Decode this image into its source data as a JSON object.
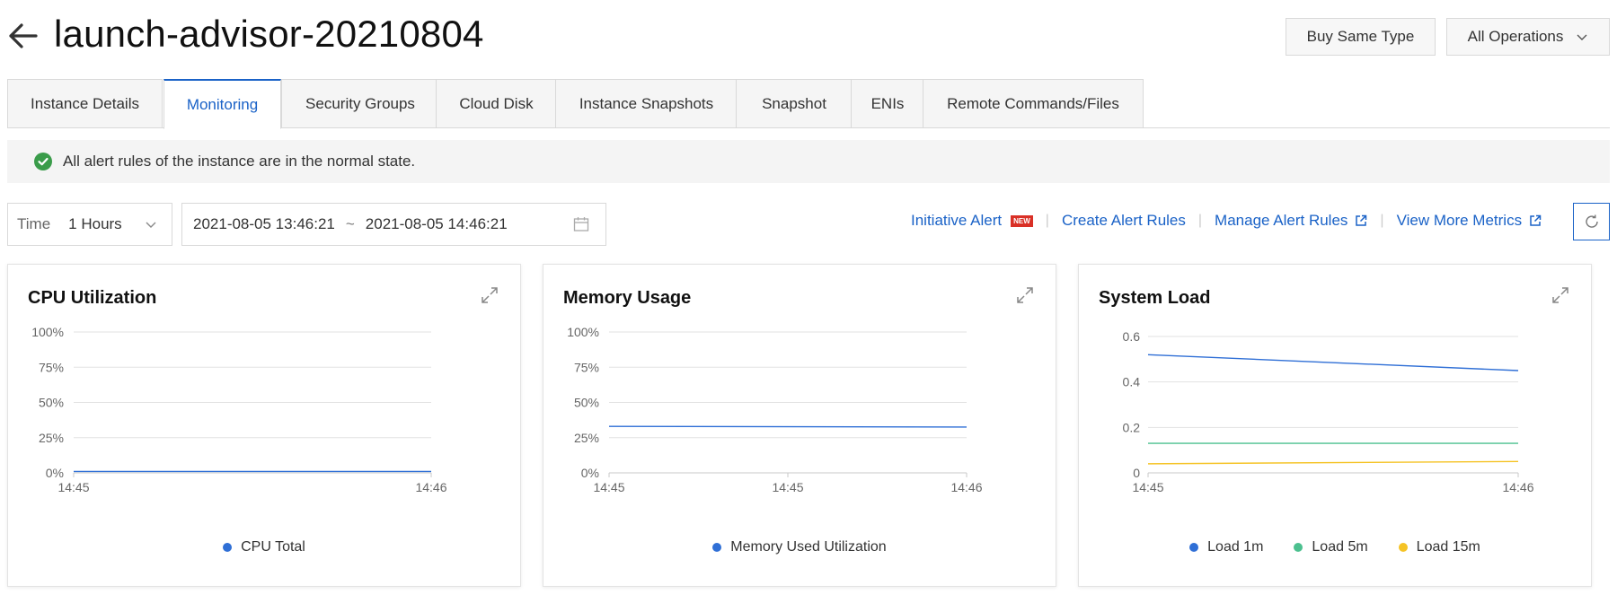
{
  "header": {
    "title": "launch-advisor-20210804",
    "buy_same_type": "Buy Same Type",
    "all_operations": "All Operations"
  },
  "tabs": [
    {
      "label": "Instance Details",
      "active": false
    },
    {
      "label": "Monitoring",
      "active": true
    },
    {
      "label": "Security Groups",
      "active": false
    },
    {
      "label": "Cloud Disk",
      "active": false
    },
    {
      "label": "Instance Snapshots",
      "active": false
    },
    {
      "label": "Snapshot",
      "active": false
    },
    {
      "label": "ENIs",
      "active": false
    },
    {
      "label": "Remote Commands/Files",
      "active": false
    }
  ],
  "alert": {
    "message": "All alert rules of the instance are in the normal state."
  },
  "time": {
    "label": "Time",
    "value": "1 Hours",
    "range_start": "2021-08-05 13:46:21",
    "range_end": "2021-08-05 14:46:21",
    "separator": "~"
  },
  "links": {
    "initiative_alert": "Initiative Alert",
    "new_badge": "NEW",
    "create_alert_rules": "Create Alert Rules",
    "manage_alert_rules": "Manage Alert Rules",
    "view_more_metrics": "View More Metrics"
  },
  "colors": {
    "accent": "#1a62c7",
    "series_blue": "#2f6fd6",
    "series_green": "#4cc08f",
    "series_yellow": "#f5c325",
    "badge_red": "#d93026",
    "ok_green": "#3a9c4a"
  },
  "chart_data": [
    {
      "type": "line",
      "title": "CPU Utilization",
      "x_ticks": [
        "14:45",
        "14:46"
      ],
      "y_ticks": [
        "100%",
        "75%",
        "50%",
        "25%",
        "0%"
      ],
      "ylim": [
        0,
        100
      ],
      "series": [
        {
          "name": "CPU Total",
          "color": "#2f6fd6",
          "values": [
            1,
            1
          ]
        }
      ]
    },
    {
      "type": "line",
      "title": "Memory Usage",
      "x_ticks": [
        "14:45",
        "14:45",
        "14:46"
      ],
      "y_ticks": [
        "100%",
        "75%",
        "50%",
        "25%",
        "0%"
      ],
      "ylim": [
        0,
        100
      ],
      "series": [
        {
          "name": "Memory Used Utilization",
          "color": "#2f6fd6",
          "values": [
            33,
            32.5
          ]
        }
      ]
    },
    {
      "type": "line",
      "title": "System Load",
      "x_ticks": [
        "14:45",
        "14:46"
      ],
      "y_ticks": [
        "0.6",
        "0.4",
        "0.2",
        "0"
      ],
      "ylim": [
        0,
        0.6
      ],
      "series": [
        {
          "name": "Load 1m",
          "color": "#2f6fd6",
          "values": [
            0.52,
            0.45
          ]
        },
        {
          "name": "Load 5m",
          "color": "#4cc08f",
          "values": [
            0.13,
            0.13
          ]
        },
        {
          "name": "Load 15m",
          "color": "#f5c325",
          "values": [
            0.04,
            0.05
          ]
        }
      ]
    }
  ]
}
